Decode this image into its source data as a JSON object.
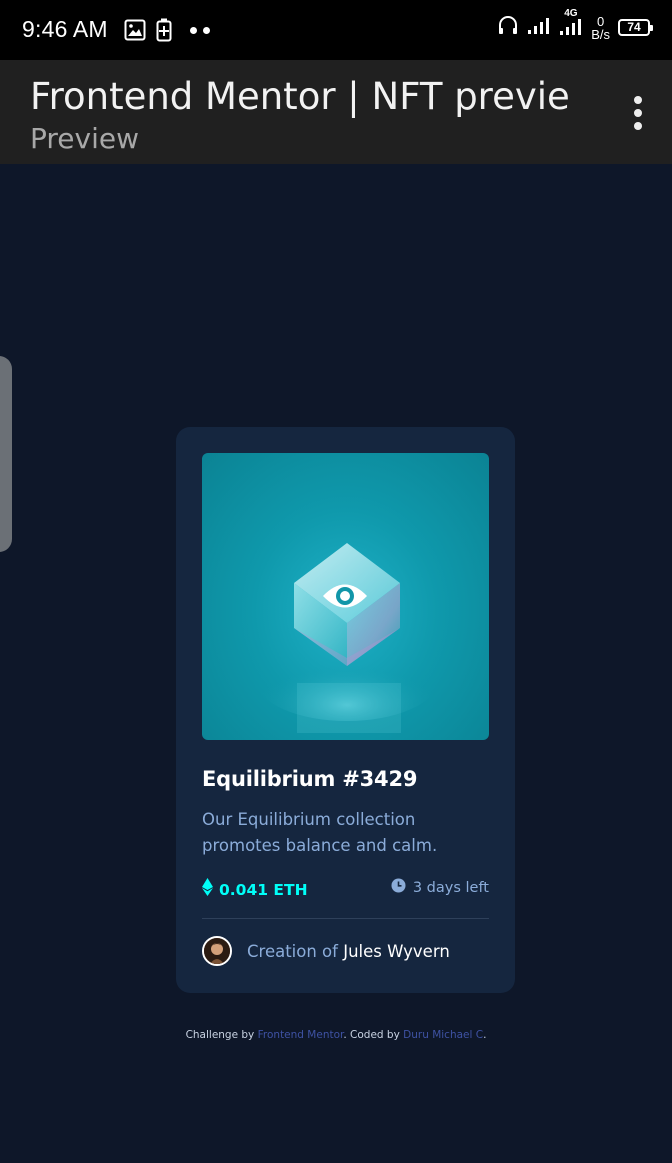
{
  "status_bar": {
    "time": "9:46 AM",
    "network": "4G",
    "speed_value": "0",
    "speed_unit": "B/s",
    "battery": "74",
    "icons": [
      "image-icon",
      "battery-saver-icon",
      "headphones-icon",
      "signal-icon"
    ]
  },
  "app_bar": {
    "title": "Frontend Mentor | NFT preview...",
    "subtitle": "Preview"
  },
  "card": {
    "title": "Equilibrium #3429",
    "description": "Our Equilibrium collection promotes balance and calm.",
    "price": "0.041 ETH",
    "time_left": "3 days left",
    "creator_prefix": "Creation of",
    "creator_name": "Jules Wyvern"
  },
  "attribution": {
    "prefix": "Challenge by",
    "link1": "Frontend Mentor",
    "middle": ". Coded by",
    "link2": "Duru Michael C",
    "suffix": "."
  },
  "colors": {
    "page_bg": "#0e1729",
    "card_bg": "#15263f",
    "cyan": "#00fff8",
    "soft_blue": "#8bacd9",
    "image_bg": "#0f99ac"
  }
}
